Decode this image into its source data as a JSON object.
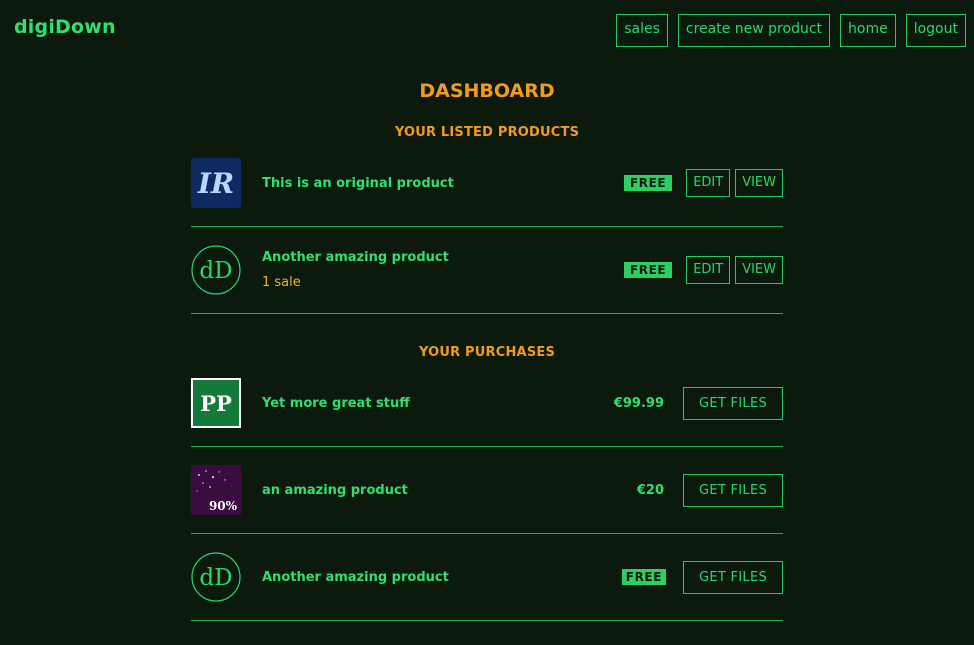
{
  "brand": "digiDown",
  "nav": {
    "sales": "sales",
    "create": "create new product",
    "home": "home",
    "logout": "logout"
  },
  "title": "DASHBOARD",
  "listed": {
    "heading": "YOUR LISTED PRODUCTS",
    "items": [
      {
        "name": "This is an original product",
        "badge": "FREE",
        "edit": "EDIT",
        "view": "VIEW",
        "thumb_text": "IR"
      },
      {
        "name": "Another amazing product",
        "sales": "1 sale",
        "badge": "FREE",
        "edit": "EDIT",
        "view": "VIEW",
        "thumb_text": "dD"
      }
    ]
  },
  "purchases": {
    "heading": "YOUR PURCHASES",
    "items": [
      {
        "name": "Yet more great stuff",
        "price": "€99.99",
        "button": "GET FILES",
        "thumb_text": "PP"
      },
      {
        "name": "an amazing product",
        "price": "€20",
        "button": "GET FILES",
        "thumb_text": "90%"
      },
      {
        "name": "Another amazing product",
        "badge": "FREE",
        "button": "GET FILES",
        "thumb_text": "dD"
      }
    ]
  },
  "colors": {
    "background": "#0b1a0c",
    "accent_green": "#27d96a",
    "heading_orange": "#f29b1d",
    "sales_yellow": "#f2b51d"
  }
}
